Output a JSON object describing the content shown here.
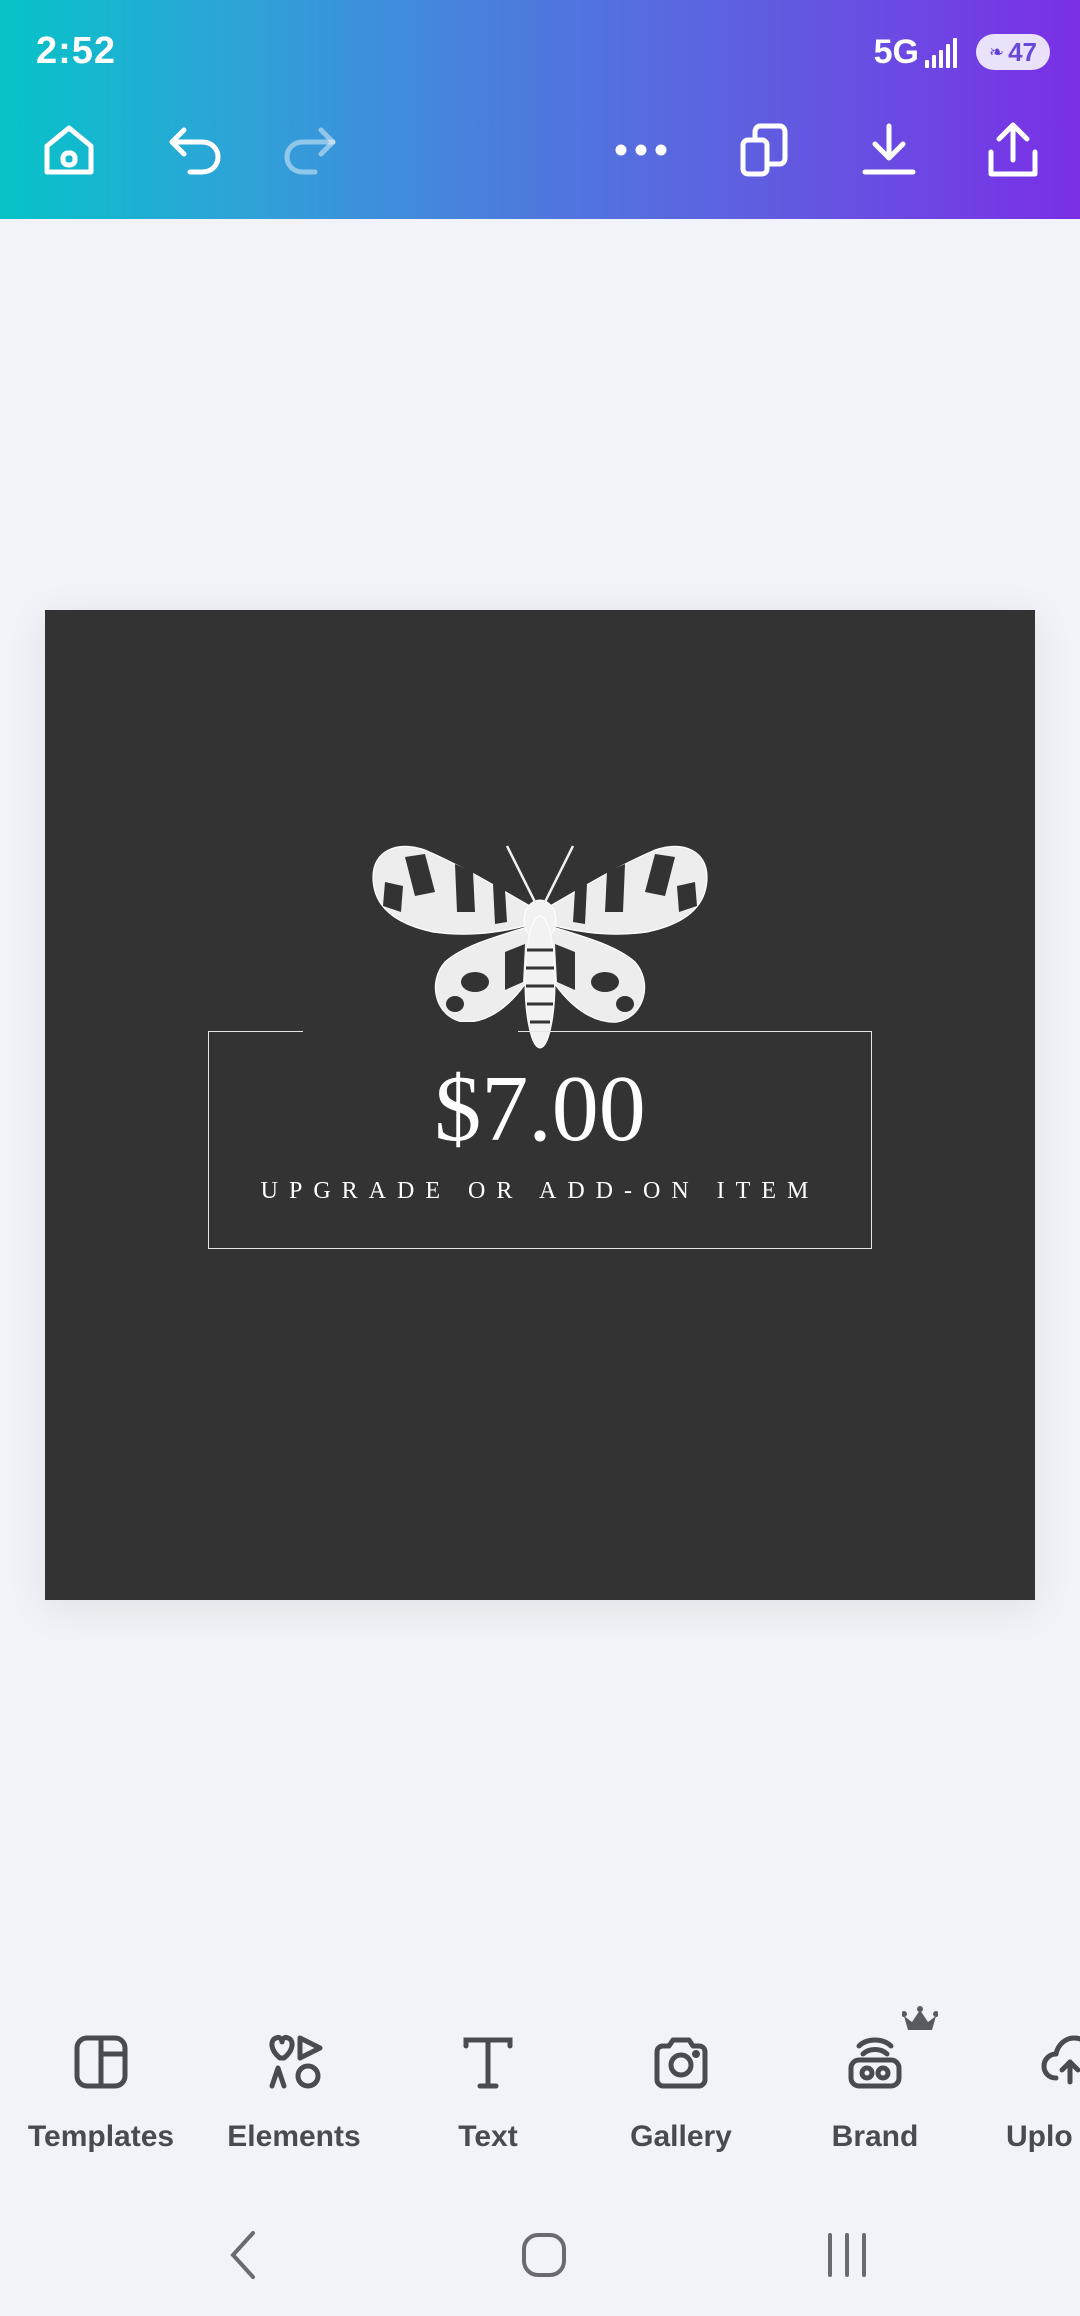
{
  "status_bar": {
    "time": "2:52",
    "network": "5G",
    "battery_level": "47"
  },
  "toolbar": {
    "home": "home-icon",
    "undo": "undo-icon",
    "redo": "redo-icon",
    "more": "more-options-icon",
    "duplicate": "duplicate-pages-icon",
    "download": "download-icon",
    "share": "share-icon"
  },
  "design": {
    "background_color": "#333333",
    "image": "moth-illustration",
    "price": "$7.00",
    "subtitle": "UPGRADE OR ADD-ON ITEM"
  },
  "bottom_tools": [
    {
      "label": "Templates",
      "icon": "templates-icon"
    },
    {
      "label": "Elements",
      "icon": "elements-icon"
    },
    {
      "label": "Text",
      "icon": "text-icon"
    },
    {
      "label": "Gallery",
      "icon": "camera-icon"
    },
    {
      "label": "Brand",
      "icon": "brand-icon",
      "premium": true
    },
    {
      "label": "Uplo",
      "icon": "upload-cloud-icon"
    }
  ],
  "nav": {
    "back": "back-icon",
    "home": "home-circle-icon",
    "recents": "recents-icon"
  },
  "colors": {
    "header_gradient_start": "#06c3c8",
    "header_gradient_end": "#7a2fe6",
    "canvas_bg": "#f2f3f8",
    "label_color": "#4a4a52"
  }
}
